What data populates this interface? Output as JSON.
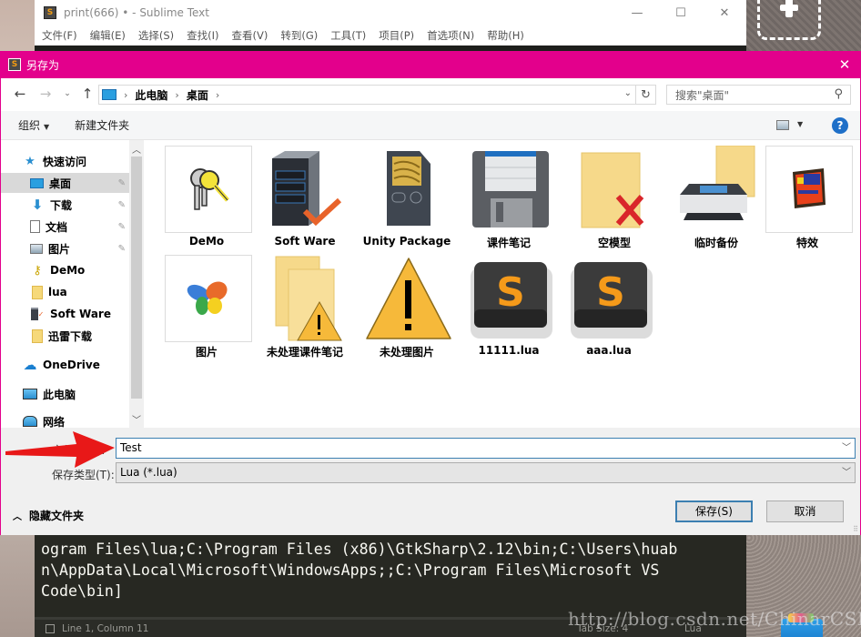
{
  "sublime": {
    "title": "print(666) • - Sublime Text",
    "app_icon": "S",
    "window_buttons": [
      "—",
      "☐",
      "✕"
    ],
    "menu": [
      "文件(F)",
      "编辑(E)",
      "选择(S)",
      "查找(I)",
      "查看(V)",
      "转到(G)",
      "工具(T)",
      "项目(P)",
      "首选项(N)",
      "帮助(H)"
    ],
    "code_lines": [
      "ogram Files\\lua;C:\\Program Files (x86)\\GtkSharp\\2.12\\bin;C:\\Users\\huab",
      "n\\AppData\\Local\\Microsoft\\WindowsApps;;C:\\Program Files\\Microsoft VS",
      "Code\\bin]"
    ],
    "status": {
      "position": "Line 1, Column 11",
      "tab_size": "Tab Size: 4",
      "syntax": "Lua"
    }
  },
  "watermark": "http://blog.csdn.net/ChinarCSDN",
  "dialog": {
    "title": "另存为",
    "close_glyph": "✕",
    "nav": {
      "back": "←",
      "forward": "→",
      "recent": "⌄",
      "up": "↑",
      "breadcrumb": [
        "此电脑",
        "桌面"
      ],
      "breadcrumb_sep": "›",
      "dropdown": "⌄",
      "refresh": "↻"
    },
    "search": {
      "placeholder": "搜索\"桌面\"",
      "icon": "⚲"
    },
    "toolbar": {
      "organize": "组织",
      "organize_caret": "▼",
      "new_folder": "新建文件夹",
      "view_caret": "▼",
      "help": "?"
    },
    "nav_pane": {
      "items": [
        {
          "label": "快速访问",
          "icon": "star-icon",
          "glyph": "★",
          "pinned": false,
          "selected": false
        },
        {
          "label": "桌面",
          "icon": "desktop-icon",
          "glyph": "",
          "pinned": true,
          "selected": true
        },
        {
          "label": "下载",
          "icon": "download-icon",
          "glyph": "🡇",
          "pinned": true,
          "selected": false
        },
        {
          "label": "文档",
          "icon": "documents-icon",
          "glyph": "",
          "pinned": true,
          "selected": false
        },
        {
          "label": "图片",
          "icon": "pictures-icon",
          "glyph": "",
          "pinned": true,
          "selected": false
        },
        {
          "label": "DeMo",
          "icon": "keys-icon",
          "glyph": "🔑",
          "pinned": false,
          "selected": false
        },
        {
          "label": "lua",
          "icon": "folder-icon",
          "glyph": "",
          "pinned": false,
          "selected": false
        },
        {
          "label": "Soft Ware",
          "icon": "server-icon",
          "glyph": "▮",
          "pinned": false,
          "selected": false
        },
        {
          "label": "迅雷下载",
          "icon": "folder-icon",
          "glyph": "",
          "pinned": false,
          "selected": false
        },
        {
          "label": "OneDrive",
          "icon": "cloud-icon",
          "glyph": "☁",
          "pinned": false,
          "selected": false
        },
        {
          "label": "此电脑",
          "icon": "computer-icon",
          "glyph": "",
          "pinned": false,
          "selected": false
        },
        {
          "label": "网络",
          "icon": "network-icon",
          "glyph": "",
          "pinned": false,
          "selected": false
        }
      ],
      "pin_glyph": "📌",
      "scroll_up": "⌃",
      "scroll_down": "⌄"
    },
    "files": [
      {
        "name": "DeMo",
        "icon": "keys-icon"
      },
      {
        "name": "Soft Ware",
        "icon": "server-check-icon"
      },
      {
        "name": "Unity Package",
        "icon": "sd-card-icon"
      },
      {
        "name": "课件笔记",
        "icon": "floppy-disk-icon"
      },
      {
        "name": "空模型",
        "icon": "folder-x-icon"
      },
      {
        "name": "临时备份",
        "icon": "printer-folder-icon"
      },
      {
        "name": "特效",
        "icon": "compact-flash-icon"
      },
      {
        "name": "图片",
        "icon": "butterfly-icon"
      },
      {
        "name": "未处理课件笔记",
        "icon": "folders-warning-icon"
      },
      {
        "name": "未处理图片",
        "icon": "warning-icon"
      },
      {
        "name": "11111.lua",
        "icon": "sublime-file-icon"
      },
      {
        "name": "aaa.lua",
        "icon": "sublime-file-icon"
      }
    ],
    "filename": {
      "label": "文件名(N):",
      "value": "Test"
    },
    "filetype": {
      "label": "保存类型(T):",
      "value": "Lua (*.lua)"
    },
    "hide_folders": "隐藏文件夹",
    "save_button": "保存(S)",
    "cancel_button": "取消"
  }
}
